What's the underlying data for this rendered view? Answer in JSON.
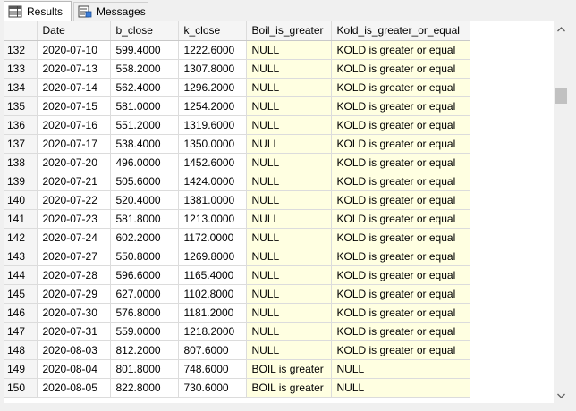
{
  "tabs": {
    "results_label": "Results",
    "messages_label": "Messages"
  },
  "columns": [
    "Date",
    "b_close",
    "k_close",
    "Boil_is_greater",
    "Kold_is_greater_or_equal"
  ],
  "rows": [
    {
      "n": "132",
      "date": "2020-07-10",
      "b": "599.4000",
      "k": "1222.6000",
      "boil": "NULL",
      "kold": "KOLD is greater or equal"
    },
    {
      "n": "133",
      "date": "2020-07-13",
      "b": "558.2000",
      "k": "1307.8000",
      "boil": "NULL",
      "kold": "KOLD is greater or equal"
    },
    {
      "n": "134",
      "date": "2020-07-14",
      "b": "562.4000",
      "k": "1296.2000",
      "boil": "NULL",
      "kold": "KOLD is greater or equal"
    },
    {
      "n": "135",
      "date": "2020-07-15",
      "b": "581.0000",
      "k": "1254.2000",
      "boil": "NULL",
      "kold": "KOLD is greater or equal"
    },
    {
      "n": "136",
      "date": "2020-07-16",
      "b": "551.2000",
      "k": "1319.6000",
      "boil": "NULL",
      "kold": "KOLD is greater or equal"
    },
    {
      "n": "137",
      "date": "2020-07-17",
      "b": "538.4000",
      "k": "1350.0000",
      "boil": "NULL",
      "kold": "KOLD is greater or equal"
    },
    {
      "n": "138",
      "date": "2020-07-20",
      "b": "496.0000",
      "k": "1452.6000",
      "boil": "NULL",
      "kold": "KOLD is greater or equal"
    },
    {
      "n": "139",
      "date": "2020-07-21",
      "b": "505.6000",
      "k": "1424.0000",
      "boil": "NULL",
      "kold": "KOLD is greater or equal"
    },
    {
      "n": "140",
      "date": "2020-07-22",
      "b": "520.4000",
      "k": "1381.0000",
      "boil": "NULL",
      "kold": "KOLD is greater or equal"
    },
    {
      "n": "141",
      "date": "2020-07-23",
      "b": "581.8000",
      "k": "1213.0000",
      "boil": "NULL",
      "kold": "KOLD is greater or equal"
    },
    {
      "n": "142",
      "date": "2020-07-24",
      "b": "602.2000",
      "k": "1172.0000",
      "boil": "NULL",
      "kold": "KOLD is greater or equal"
    },
    {
      "n": "143",
      "date": "2020-07-27",
      "b": "550.8000",
      "k": "1269.8000",
      "boil": "NULL",
      "kold": "KOLD is greater or equal"
    },
    {
      "n": "144",
      "date": "2020-07-28",
      "b": "596.6000",
      "k": "1165.4000",
      "boil": "NULL",
      "kold": "KOLD is greater or equal"
    },
    {
      "n": "145",
      "date": "2020-07-29",
      "b": "627.0000",
      "k": "1102.8000",
      "boil": "NULL",
      "kold": "KOLD is greater or equal"
    },
    {
      "n": "146",
      "date": "2020-07-30",
      "b": "576.8000",
      "k": "1181.2000",
      "boil": "NULL",
      "kold": "KOLD is greater or equal"
    },
    {
      "n": "147",
      "date": "2020-07-31",
      "b": "559.0000",
      "k": "1218.2000",
      "boil": "NULL",
      "kold": "KOLD is greater or equal"
    },
    {
      "n": "148",
      "date": "2020-08-03",
      "b": "812.2000",
      "k": "807.6000",
      "boil": "NULL",
      "kold": "KOLD is greater or equal"
    },
    {
      "n": "149",
      "date": "2020-08-04",
      "b": "801.8000",
      "k": "748.6000",
      "boil": "BOIL is greater",
      "kold": "NULL"
    },
    {
      "n": "150",
      "date": "2020-08-05",
      "b": "822.8000",
      "k": "730.6000",
      "boil": "BOIL is greater",
      "kold": "NULL"
    }
  ],
  "colors": {
    "highlight_cell": "#ffffe1",
    "header_bg": "#f5f5f5",
    "grid_line": "#dcdcdc"
  },
  "icons": {
    "results_tab": "grid-table-icon",
    "messages_tab": "messages-icon",
    "scroll_up": "chevron-up-icon",
    "scroll_down": "chevron-down-icon"
  }
}
